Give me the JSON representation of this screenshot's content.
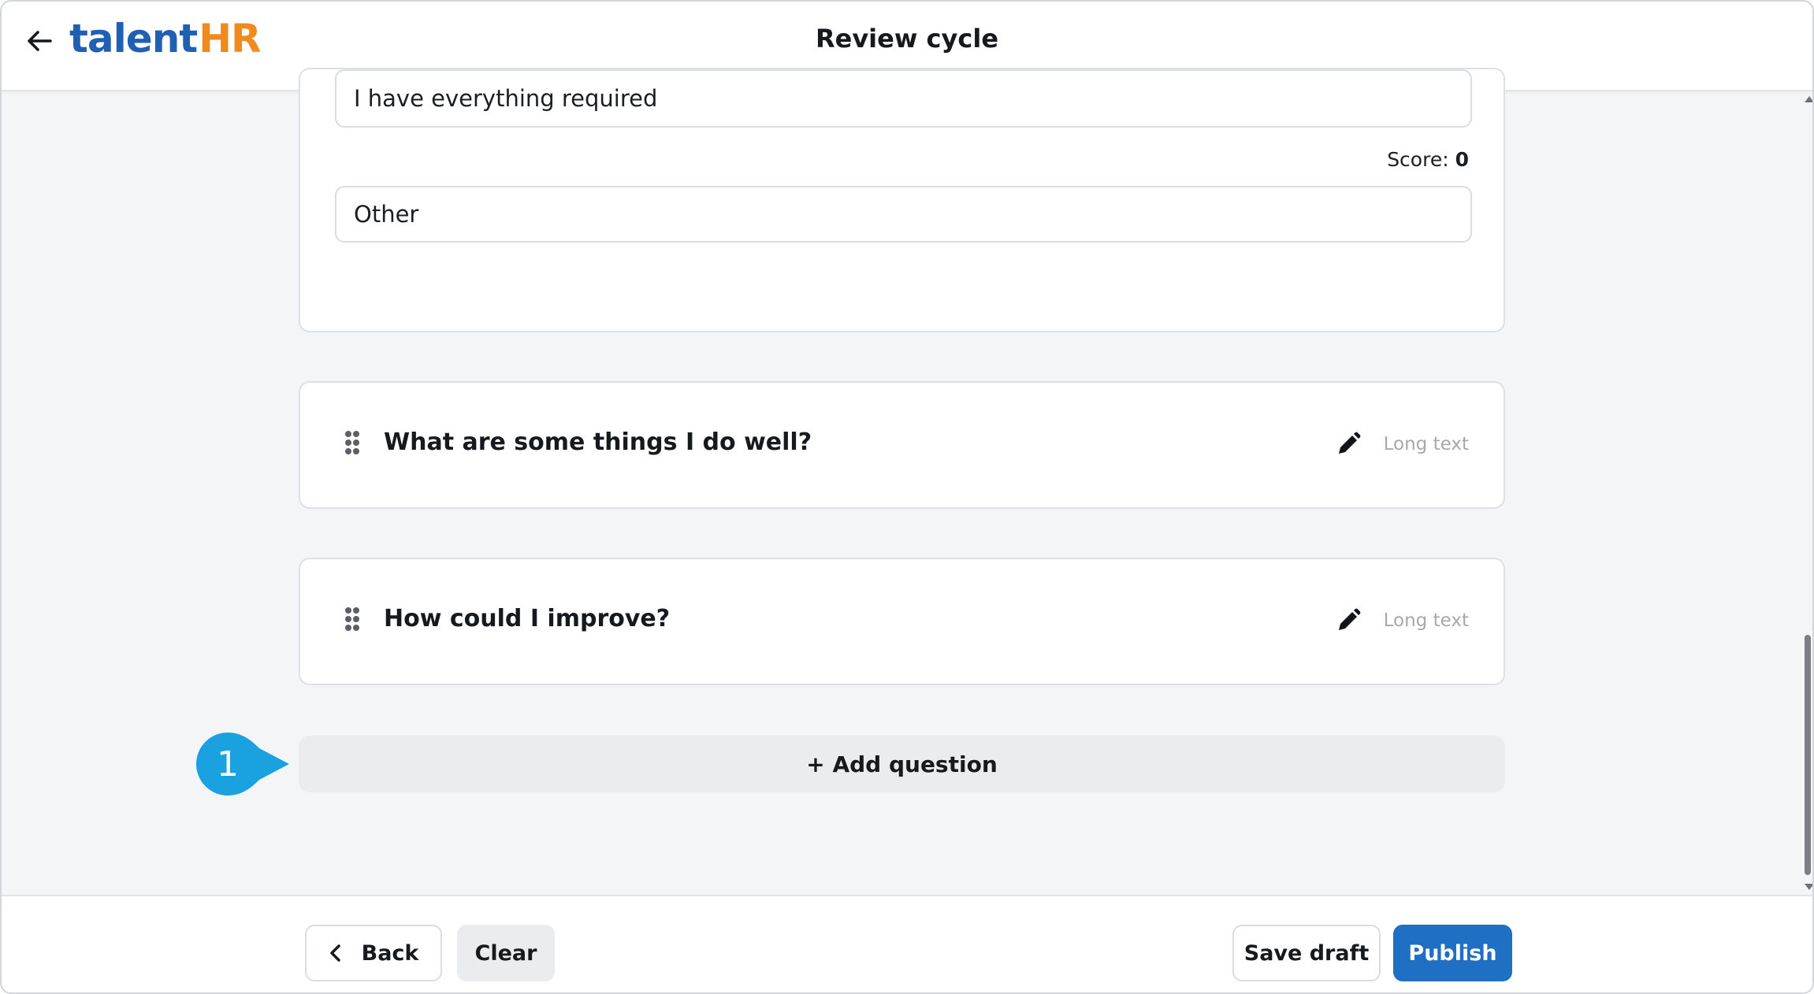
{
  "header": {
    "logo_part1": "talent",
    "logo_part2": "HR",
    "title": "Review cycle"
  },
  "options": [
    {
      "text": "I have everything required"
    },
    {
      "text": "Other"
    }
  ],
  "score": {
    "label": "Score:",
    "value": "0"
  },
  "questions": [
    {
      "text": "What are some things I do well?",
      "type": "Long text"
    },
    {
      "text": "How could I improve?",
      "type": "Long text"
    }
  ],
  "add_question": {
    "label": "+ Add question"
  },
  "callout": {
    "number": "1",
    "color": "#1aa1e0"
  },
  "footer": {
    "back_label": "Back",
    "clear_label": "Clear",
    "save_label": "Save draft",
    "publish_label": "Publish"
  },
  "colors": {
    "brand_blue": "#1f5fb4",
    "brand_orange": "#f08a1c",
    "primary_button": "#1f6fc4"
  },
  "icons": {
    "back": "arrow-left-icon",
    "drag": "drag-handle-icon",
    "edit": "pencil-icon",
    "back_button": "chevron-left-icon"
  }
}
